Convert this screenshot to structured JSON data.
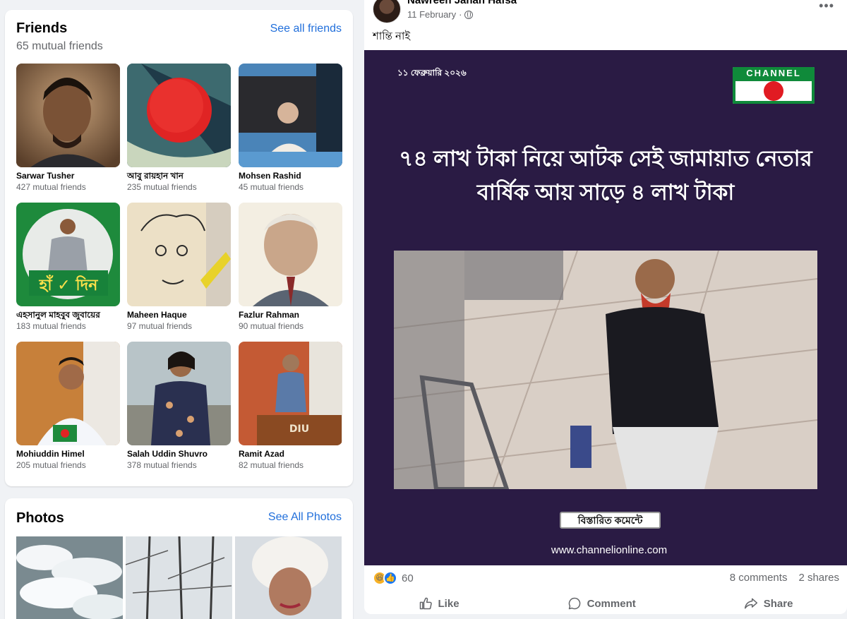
{
  "friends": {
    "title": "Friends",
    "subtitle": "65 mutual friends",
    "see_all": "See all friends",
    "items": [
      {
        "name": "Sarwar Tusher",
        "mutual": "427 mutual friends"
      },
      {
        "name": "আবু রায়হান খান",
        "mutual": "235 mutual friends"
      },
      {
        "name": "Mohsen Rashid",
        "mutual": "45 mutual friends"
      },
      {
        "name": "এহসানুল মাহবুব জুবায়ের",
        "mutual": "183 mutual friends"
      },
      {
        "name": "Maheen Haque",
        "mutual": "97 mutual friends"
      },
      {
        "name": "Fazlur Rahman",
        "mutual": "90 mutual friends"
      },
      {
        "name": "Mohiuddin Himel",
        "mutual": "205 mutual friends"
      },
      {
        "name": "Salah Uddin Shuvro",
        "mutual": "378 mutual friends"
      },
      {
        "name": "Ramit Azad",
        "mutual": "82 mutual friends"
      }
    ]
  },
  "photos": {
    "title": "Photos",
    "see_all": "See All Photos"
  },
  "post": {
    "author": "Nawreen Jahan Hafsa",
    "date": "11 February",
    "privacy_icon": "globe-icon",
    "text": "শান্তি নাই",
    "image": {
      "date": "১১ ফেব্রুয়ারি ২০২৬",
      "logo": "CHANNEL",
      "headline_line1": "৭৪ লাখ টাকা নিয়ে আটক সেই জামায়াত নেতার",
      "headline_line2": "বার্ষিক আয় সাড়ে ৪ লাখ টাকা",
      "details_button": "বিস্তারিত কমেন্টে",
      "website": "www.channelionline.com"
    },
    "reaction_count": "60",
    "comments": "8 comments",
    "shares": "2 shares",
    "actions": {
      "like": "Like",
      "comment": "Comment",
      "share": "Share"
    }
  },
  "colors": {
    "link": "#216fdb",
    "secondary_text": "#65676b",
    "post_image_bg": "#2a1b44"
  }
}
